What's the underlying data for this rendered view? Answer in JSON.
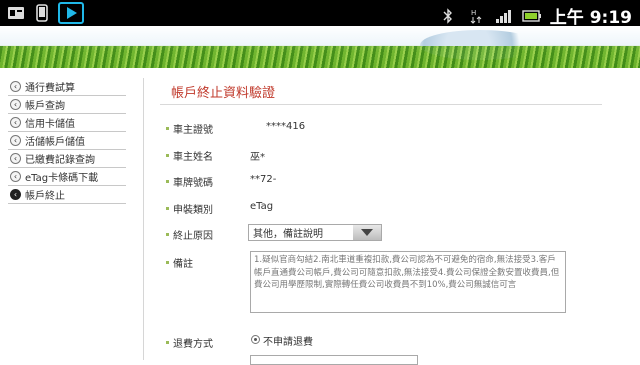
{
  "status_bar": {
    "time": "上午 9:19",
    "icons": [
      "sim-icon",
      "phone-icon",
      "play-store-icon",
      "bluetooth-icon",
      "data-arrows-icon",
      "signal-icon",
      "battery-icon"
    ]
  },
  "sidebar": {
    "items": [
      {
        "label": "通行費試算",
        "active": false
      },
      {
        "label": "帳戶查詢",
        "active": false
      },
      {
        "label": "信用卡儲值",
        "active": false
      },
      {
        "label": "活儲帳戶儲值",
        "active": false
      },
      {
        "label": "已繳費記錄查詢",
        "active": false
      },
      {
        "label": "eTag卡條碼下載",
        "active": false
      },
      {
        "label": "帳戶終止",
        "active": true
      }
    ]
  },
  "main": {
    "title": "帳戶終止資料驗證",
    "fields": {
      "id_label": "車主證號",
      "id_value": "****416",
      "name_label": "車主姓名",
      "name_value": "巫*",
      "plate_label": "車牌號碼",
      "plate_value": "**72-",
      "type_label": "申裝類別",
      "type_value": "eTag",
      "reason_label": "終止原因",
      "reason_value": "其他，備註說明",
      "note_label": "備註",
      "note_value": "1.疑似官商勾結2.南北車道重複扣款,費公司認為不可避免的宿命,無法接受3.客戶帳戶直通費公司帳戶,費公司可隨意扣款,無法接受4.費公司保證全數安置收費員,但費公司用學歷限制,實際轉任費公司收費員不到10%,費公司無誠信可言",
      "refund_label": "退費方式",
      "refund_option": "不申請退費"
    }
  },
  "colors": {
    "title": "#c0392b",
    "accent_bullet": "#9bbb59"
  }
}
